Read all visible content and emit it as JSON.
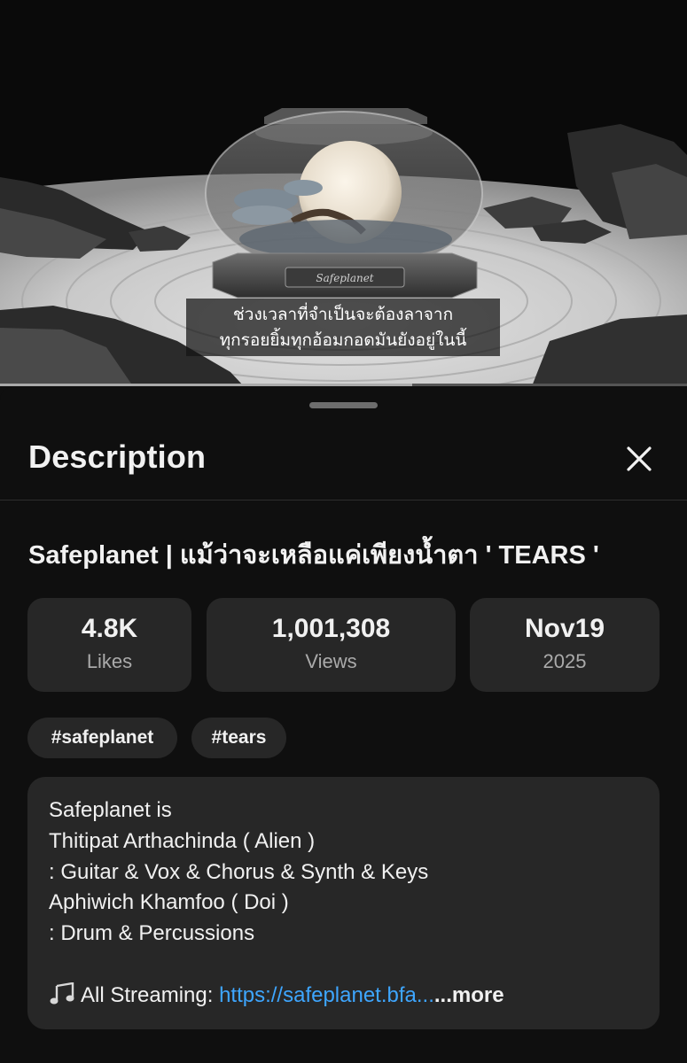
{
  "video": {
    "caption_line1": "ช่วงเวลาที่จำเป็นจะต้องลาจาก",
    "caption_line2": "ทุกรอยยิ้มทุกอ้อมกอดมันยังอยู่ในนี้",
    "logo_text": "Safeplanet",
    "progress_fraction": 0.6
  },
  "sheet": {
    "title": "Description",
    "close_icon": "close-icon"
  },
  "video_title": "Safeplanet | แม้ว่าจะเหลือแค่เพียงน้ำตา ' TEARS '",
  "stats": {
    "likes": {
      "value": "4.8K",
      "label": "Likes"
    },
    "views": {
      "value": "1,001,308",
      "label": "Views"
    },
    "date": {
      "value": "Nov19",
      "label": "2025"
    }
  },
  "hashtags": [
    "#safeplanet",
    "#tears"
  ],
  "description": {
    "lines": [
      "Safeplanet is",
      "Thitipat Arthachinda ( Alien )",
      ": Guitar & Vox & Chorus & Synth & Keys",
      "Aphiwich Khamfoo ( Doi )",
      ": Drum & Percussions"
    ],
    "streaming_icon": "music-note-icon",
    "streaming_label": "All Streaming: ",
    "streaming_link": "https://safeplanet.bfa...",
    "more_label": "...more"
  },
  "colors": {
    "background": "#0f0f0f",
    "card": "#272727",
    "link": "#3ea6ff",
    "secondary_text": "#aaaaaa"
  }
}
